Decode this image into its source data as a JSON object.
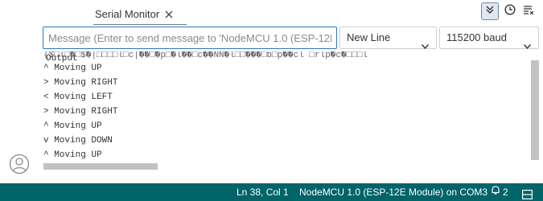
{
  "tabs": {
    "output_label": "Output",
    "serial_label": "Serial Monitor"
  },
  "input": {
    "placeholder": "Message (Enter to send message to 'NodeMCU 1.0 (ESP-12E Module)' on 'COM3')",
    "value": ""
  },
  "line_ending": {
    "selected": "New Line"
  },
  "baud": {
    "selected": "115200 baud"
  },
  "output_lines": [
    "{$□l□�□$�|□□□□l□c|��□�p□�l��□c��NN�l□□���□b□p��cl □rlp�c�□□□l",
    "^ Moving UP",
    "> Moving RIGHT",
    "< Moving LEFT",
    "> Moving RIGHT",
    "^ Moving UP",
    "v Moving DOWN",
    "^ Moving UP"
  ],
  "status": {
    "position": "Ln 38, Col 1",
    "board": "NodeMCU 1.0 (ESP-12E Module) on COM3",
    "notifications": "2"
  },
  "colors": {
    "statusbar": "#006468",
    "input_focus": "#2f74c0"
  },
  "icons": [
    "account-icon",
    "close-icon",
    "autoscroll-icon",
    "clock-icon",
    "clear-output-icon",
    "chevron-down-icon",
    "bell-icon",
    "console-icon"
  ]
}
